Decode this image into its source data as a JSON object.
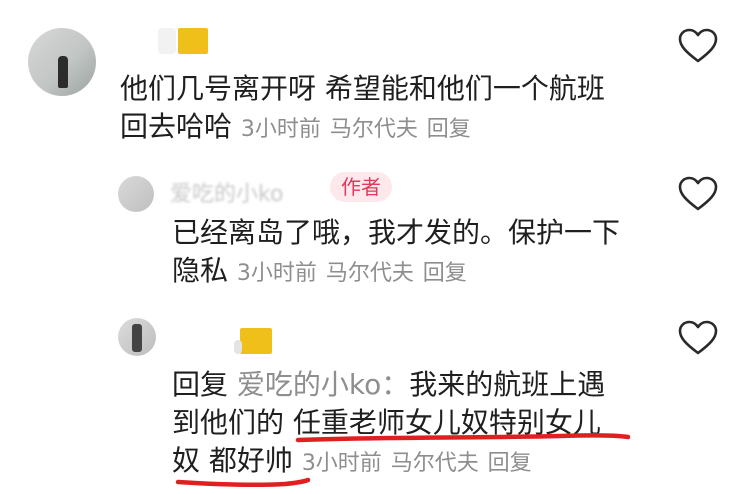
{
  "comments": [
    {
      "text_line1": "他们几号离开呀 希望能和他们一个航班",
      "text_line2": "回去哈哈",
      "time": "3小时前",
      "location": "马尔代夫",
      "reply": "回复"
    },
    {
      "author_tag": "作者",
      "username_blurred": "爱吃的小ko",
      "text_line1": "已经离岛了哦，我才发的。保护一下",
      "text_line2": "隐私",
      "time": "3小时前",
      "location": "马尔代夫",
      "reply": "回复"
    },
    {
      "reply_prefix": "回复",
      "reply_to": "爱吃的小ko：",
      "text_line1": "我来的航班上遇",
      "text_line2": "到他们的 任重老师女儿奴特别女儿",
      "text_line3": "奴 都好帅",
      "time": "3小时前",
      "location": "马尔代夫",
      "reply": "回复"
    }
  ],
  "icons": {
    "like": "heart-outline-icon"
  },
  "colors": {
    "author_tag_bg": "#fde8ec",
    "author_tag_text": "#e0395d",
    "meta_gray": "#8e8e8e",
    "underline_red": "#e02020",
    "badge_yellow": "#efbf1a"
  }
}
